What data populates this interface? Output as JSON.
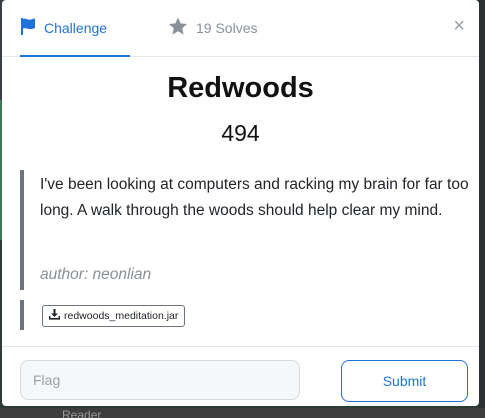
{
  "tabs": {
    "challenge_label": "Challenge",
    "solves_label": "19 Solves",
    "close_label": "×"
  },
  "challenge": {
    "title": "Redwoods",
    "points": "494",
    "description": "I've been looking at computers and racking my brain for far too long. A walk through the woods should help clear my mind.",
    "author": "author: neonlian",
    "file_name": "redwoods_meditation.jar"
  },
  "form": {
    "flag_placeholder": "Flag",
    "submit_label": "Submit"
  },
  "background": {
    "bottom_text": "Reader"
  },
  "colors": {
    "accent": "#1f73d8",
    "muted": "#8a9099",
    "border_left": "#6c757d"
  },
  "icons": {
    "challenge_tab": "flag-icon",
    "solves_tab": "star-icon",
    "file": "download-icon",
    "close": "close-icon"
  }
}
